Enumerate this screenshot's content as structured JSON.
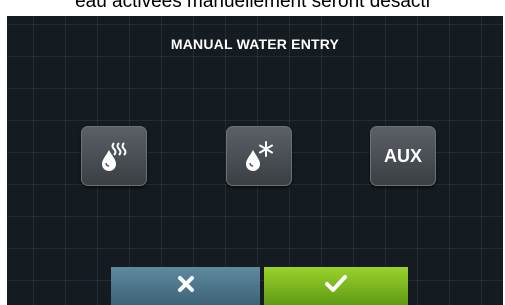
{
  "caption": "eau activées manuellement seront désacti",
  "screen": {
    "title": "MANUAL WATER ENTRY"
  },
  "buttons": {
    "hot_water": {
      "icon": "hot-water-drop-icon"
    },
    "cold_water": {
      "icon": "cold-water-drop-icon"
    },
    "aux": {
      "label": "AUX"
    },
    "cancel": {
      "icon": "close-icon"
    },
    "confirm": {
      "icon": "checkmark-icon"
    }
  },
  "colors": {
    "screen_background": "#141b21",
    "cancel_button": "#4f7a90",
    "confirm_button": "#7fbf1f",
    "icon_button": "#4a5056"
  }
}
